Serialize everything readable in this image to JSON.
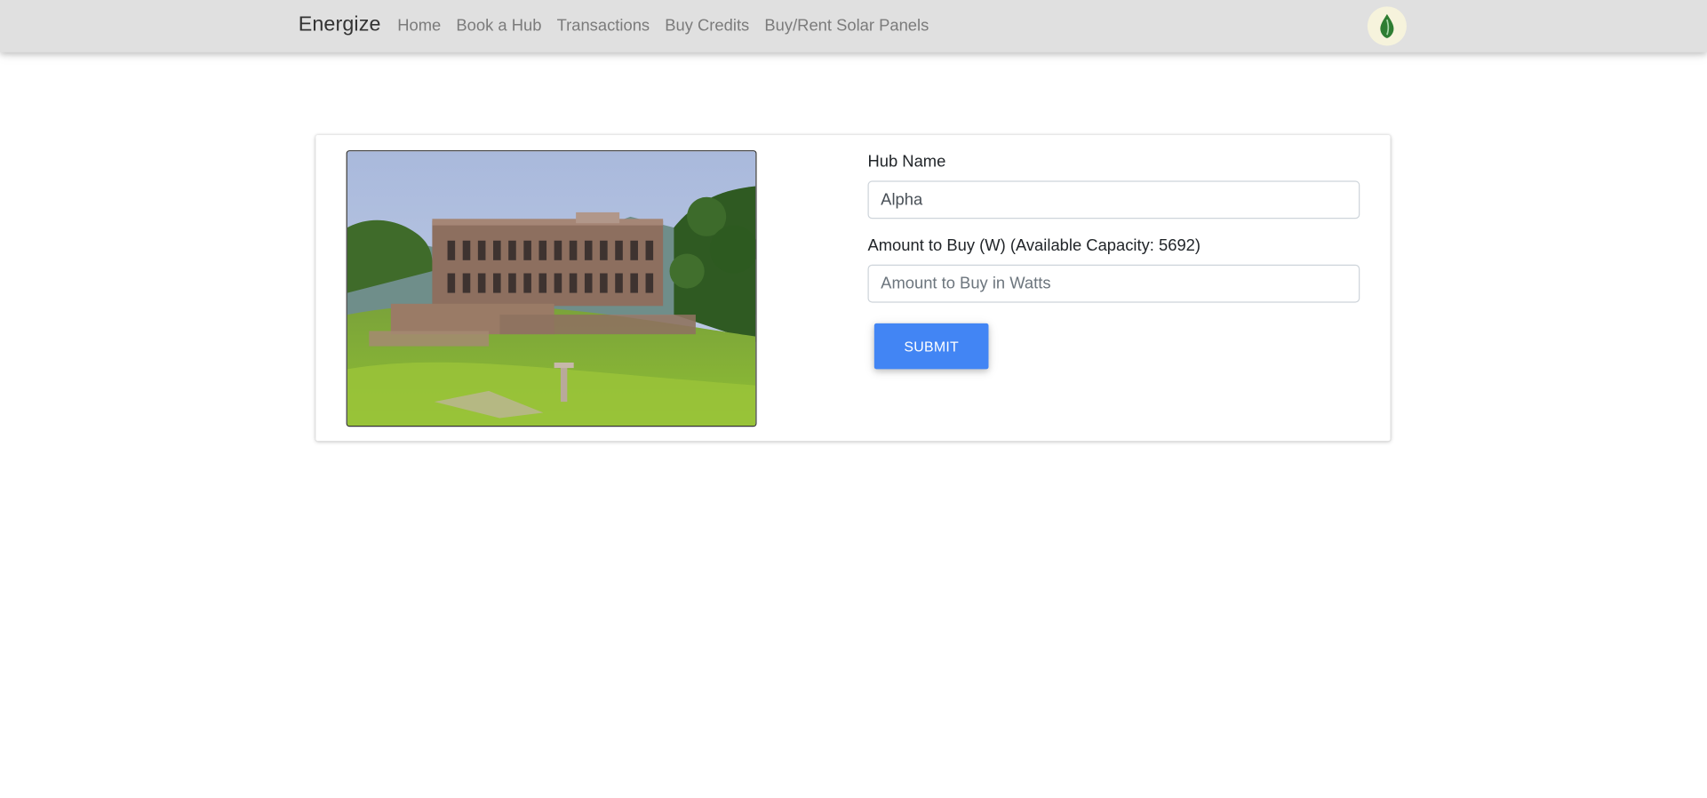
{
  "navbar": {
    "brand": "Energize",
    "links": [
      "Home",
      "Book a Hub",
      "Transactions",
      "Buy Credits",
      "Buy/Rent Solar Panels"
    ],
    "avatar_icon": "leaf-drop-icon",
    "accent": "#2e7d32"
  },
  "hub": {
    "image": "hub-photo",
    "form": {
      "hub_name_label": "Hub Name",
      "hub_name_value": "Alpha",
      "amount_label": "Amount to Buy (W) (Available Capacity: 5692)",
      "amount_placeholder": "Amount to Buy in Watts",
      "submit_label": "SUBMIT"
    }
  },
  "colors": {
    "navbar_bg": "#e0e0e0",
    "primary_button": "#4285f4"
  }
}
